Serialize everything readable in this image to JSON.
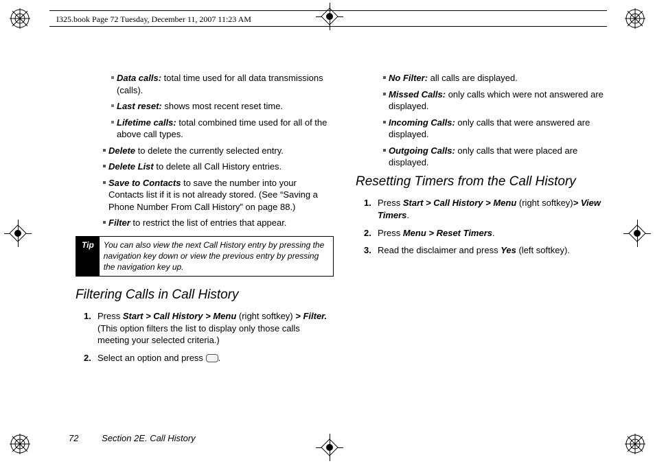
{
  "header": "I325.book  Page 72  Tuesday, December 11, 2007  11:23 AM",
  "left": {
    "data_calls_label": "Data calls:",
    "data_calls_text": " total time used for all data transmissions (calls).",
    "last_reset_label": "Last reset:",
    "last_reset_text": " shows most recent reset time.",
    "lifetime_label": "Lifetime calls:",
    "lifetime_text": " total combined time used for all of the above call types.",
    "delete_label": "Delete",
    "delete_text": " to delete the currently selected entry.",
    "delete_list_label": "Delete List",
    "delete_list_text": " to delete all Call History entries.",
    "save_label": "Save to Contacts",
    "save_text": " to save the number into your Contacts list if it is not already stored. (See “Saving a Phone Number From Call History” on page 88.)",
    "filter_label": "Filter",
    "filter_text": " to restrict the list of entries that appear.",
    "tip_label": "Tip",
    "tip_text": "You can also view the next Call History entry by pressing the navigation key down or view the previous entry by pressing the navigation key up.",
    "heading_filter": "Filtering Calls in Call History",
    "step1a": "Press ",
    "step1b": "Start > Call History > Menu",
    "step1c": " (right softkey) ",
    "step1d": "> Filter.",
    "step1e": " (This option filters the list to display only those calls meeting your selected criteria.)",
    "step2a": "Select an option and press ",
    "step2b": "."
  },
  "right": {
    "nofilter_label": "No Filter:",
    "nofilter_text": " all calls are displayed.",
    "missed_label": "Missed Calls:",
    "missed_text": " only calls which were not answered are displayed.",
    "incoming_label": "Incoming Calls:",
    "incoming_text": " only calls that were answered are displayed.",
    "outgoing_label": "Outgoing Calls:",
    "outgoing_text": " only calls that were placed are displayed.",
    "heading_reset": "Resetting Timers from the Call History",
    "r1a": "Press ",
    "r1b": "Start > Call History > Menu",
    "r1c": " (right softkey)",
    "r1d": "> View Timers",
    "r1e": ".",
    "r2a": "Press ",
    "r2b": "Menu > Reset Timers",
    "r2c": ".",
    "r3a": "Read the disclaimer and press ",
    "r3b": "Yes",
    "r3c": " (left softkey)."
  },
  "footer": {
    "page": "72",
    "section": "Section 2E. Call History"
  }
}
